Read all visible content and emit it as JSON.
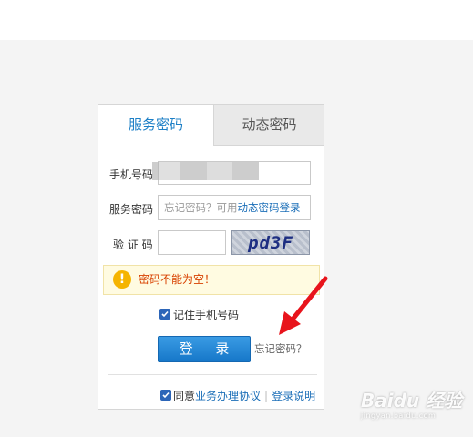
{
  "tabs": [
    {
      "label": "服务密码",
      "active": true
    },
    {
      "label": "动态密码",
      "active": false
    }
  ],
  "form": {
    "phone_label": "手机号码",
    "password_label": "服务密码",
    "password_placeholder_prefix": "忘记密码？可用",
    "password_placeholder_link": "动态密码登录",
    "captcha_label": "验 证 码",
    "captcha_image_text": "pd3F"
  },
  "alert": {
    "icon": "warning-icon",
    "message": "密码不能为空！"
  },
  "remember": {
    "label": "记住手机号码",
    "checked": true
  },
  "login_button": "登 录",
  "forgot_link": "忘记密码？",
  "agreement": {
    "prefix": "同意",
    "link1": "业务办理协议",
    "separator": "|",
    "link2": "登录说明",
    "checked": true
  },
  "watermark": {
    "main": "Baidu 经验",
    "sub": "jingyan.baidu.com"
  },
  "colors": {
    "accent": "#1c7fc6",
    "button": "#1677c9",
    "alert_text": "#d84100",
    "annotation_arrow": "#e8141c"
  }
}
